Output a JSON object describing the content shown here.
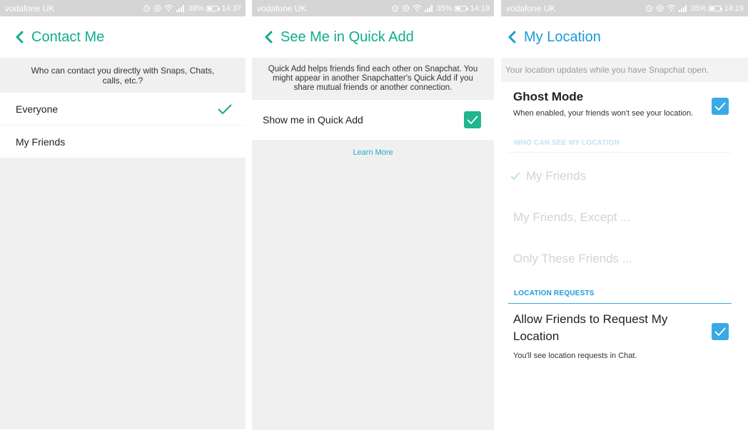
{
  "colors": {
    "green_accent": "#0fad8f",
    "blue_accent": "#1a9bd6",
    "status_bar": "#d5d5d5",
    "light_gray": "#f0f0f0"
  },
  "panels": [
    {
      "status": {
        "carrier": "vodafone UK",
        "battery": "38%",
        "time": "14:37",
        "battery_level": 0.38
      },
      "header": {
        "title": "Contact Me",
        "back_icon": "chevron-left-icon"
      },
      "description": "Who can contact you directly with Snaps, Chats, calls, etc.?",
      "options": [
        {
          "label": "Everyone",
          "selected": true
        },
        {
          "label": "My Friends",
          "selected": false
        }
      ]
    },
    {
      "status": {
        "carrier": "vodafone UK",
        "battery": "35%",
        "time": "14:19",
        "battery_level": 0.35
      },
      "header": {
        "title": "See Me in Quick Add",
        "back_icon": "chevron-left-icon"
      },
      "description": "Quick Add helps friends find each other on Snapchat. You might appear in another Snapchatter's Quick Add if you share mutual friends or another connection.",
      "toggle": {
        "label": "Show me in Quick Add",
        "checked": true
      },
      "learn_more": "Learn More"
    },
    {
      "status": {
        "carrier": "vodafone UK",
        "battery": "35%",
        "time": "14:19",
        "battery_level": 0.35
      },
      "header": {
        "title": "My Location",
        "back_icon": "chevron-left-icon"
      },
      "info": "Your location updates while you have Snapchat open.",
      "ghost_mode": {
        "title": "Ghost Mode",
        "description": "When enabled, your friends won't see your location.",
        "checked": true
      },
      "who_can_see_header": "WHO CAN SEE MY LOCATION",
      "location_options": [
        {
          "label": "My Friends",
          "selected": true
        },
        {
          "label": "My Friends, Except ...",
          "selected": false
        },
        {
          "label": "Only These Friends ...",
          "selected": false
        }
      ],
      "location_requests_header": "LOCATION REQUESTS",
      "allow_requests": {
        "title": "Allow Friends to Request My Location",
        "description": "You'll see location requests in Chat.",
        "checked": true
      }
    }
  ]
}
